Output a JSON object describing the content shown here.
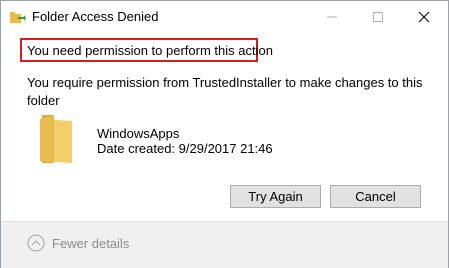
{
  "window": {
    "title": "Folder Access Denied"
  },
  "dialog": {
    "headline": "You need permission to perform this action",
    "description": "You require permission from TrustedInstaller to make changes to this folder",
    "item": {
      "name": "WindowsApps",
      "date_created": "Date created: 9/29/2017 21:46"
    },
    "buttons": {
      "try_again": "Try Again",
      "cancel": "Cancel"
    }
  },
  "footer": {
    "fewer_details": "Fewer details"
  },
  "icons": {
    "app": "folder-move-icon",
    "folder": "folder-icon",
    "fewer": "chevron-up-circle-icon"
  },
  "colors": {
    "highlight_border": "#d21f1f",
    "folder": "#f2cf6b",
    "button_bg": "#e1e1e1",
    "footer_bg": "#f0f0f0"
  }
}
